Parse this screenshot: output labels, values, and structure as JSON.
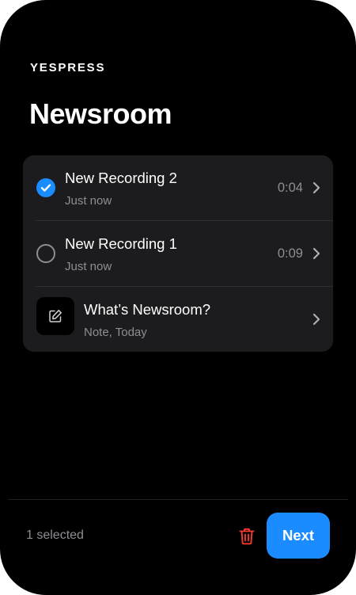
{
  "app": {
    "brand": "YESPRESS",
    "title": "Newsroom"
  },
  "list": {
    "items": [
      {
        "title": "New Recording 2",
        "subtitle": "Just now",
        "duration": "0:04",
        "selected": true,
        "icon": "checkmark-circle-icon"
      },
      {
        "title": "New Recording 1",
        "subtitle": "Just now",
        "duration": "0:09",
        "selected": false,
        "icon": "empty-circle-icon"
      },
      {
        "title": "What’s Newsroom?",
        "subtitle": "Note, Today",
        "icon": "edit-note-icon"
      }
    ]
  },
  "footer": {
    "selection_count": "1 selected",
    "delete_icon": "trash-icon",
    "next_label": "Next"
  },
  "colors": {
    "background": "#000000",
    "card": "#1c1c1e",
    "accent": "#1a8cff",
    "secondary_text": "#8e8e93",
    "destructive": "#ff3b30"
  }
}
